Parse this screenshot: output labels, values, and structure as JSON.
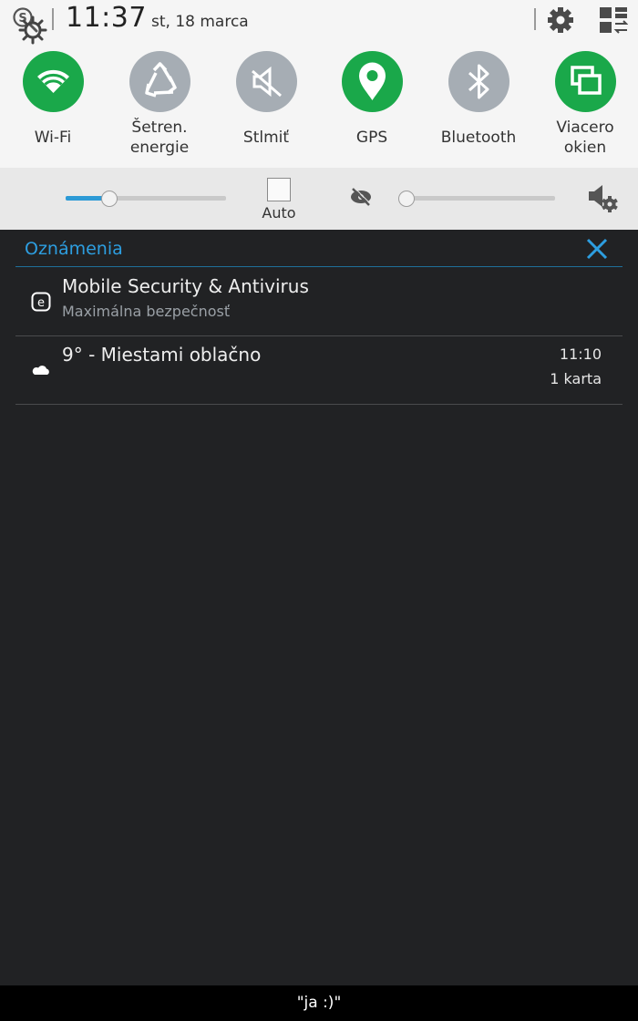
{
  "header": {
    "time": "11:37",
    "date": "st, 18 marca",
    "icons": [
      "search-icon",
      "settings-gear-icon",
      "quick-panel-edit-icon"
    ]
  },
  "toggles": [
    {
      "label": "Wi-Fi",
      "icon": "wifi-icon",
      "on": true
    },
    {
      "label": "Šetren. energie",
      "line1": "Šetren.",
      "line2": "energie",
      "icon": "recycle-icon",
      "on": false
    },
    {
      "label": "Stlmiť",
      "icon": "mute-icon",
      "on": false
    },
    {
      "label": "GPS",
      "icon": "location-pin-icon",
      "on": true
    },
    {
      "label": "Bluetooth",
      "icon": "bluetooth-icon",
      "on": false
    },
    {
      "label": "Viacero okien",
      "line1": "Viacero",
      "line2": "okien",
      "icon": "multi-window-icon",
      "on": true
    }
  ],
  "sliders": {
    "brightness": {
      "level": 0.27,
      "icon": "brightness-icon"
    },
    "auto_label": "Auto",
    "auto_checked": false,
    "second": {
      "level": 0.0,
      "icon": "smart-stay-icon"
    },
    "sound_icon": "sound-settings-icon"
  },
  "notifications": {
    "title": "Oznámenia",
    "items": [
      {
        "icon": "e-app-icon",
        "title": "Mobile Security & Antivirus",
        "subtitle": "Maximálna bezpečnosť"
      },
      {
        "icon": "cloud-icon",
        "title": "9° - Miestami oblačno",
        "time": "11:10",
        "count": "1 karta"
      }
    ]
  },
  "footer": {
    "caption": "\"ja :)\""
  },
  "colors": {
    "accent": "#2d9ee0",
    "toggle_on": "#1aa84a",
    "toggle_off": "#a6adb4",
    "panel_bg": "#212224"
  }
}
